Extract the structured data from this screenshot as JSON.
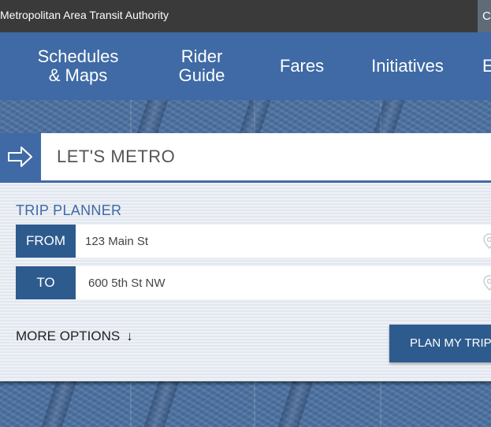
{
  "topbar": {
    "agency_name": "Metropolitan Area Transit Authority",
    "search_fragment": "C"
  },
  "nav": {
    "items": [
      {
        "label": "Schedules\n& Maps"
      },
      {
        "label": "Rider\nGuide"
      },
      {
        "label": "Fares"
      },
      {
        "label": "Initiatives"
      },
      {
        "label": "E"
      }
    ]
  },
  "hero": {
    "lets_metro": "LET'S METRO"
  },
  "trip_planner": {
    "title": "TRIP PLANNER",
    "from_label": "FROM",
    "from_value": "123 Main St",
    "to_label": "TO",
    "to_value": "600 5th St NW",
    "more_options": "MORE OPTIONS",
    "more_options_arrow": "↓",
    "plan_button": "PLAN MY TRIP"
  },
  "colors": {
    "topbar": "#3a3a3a",
    "nav": "#3f6aa5",
    "accent_dark": "#2e5b8e",
    "planner_bg": "#e8ecf3"
  }
}
